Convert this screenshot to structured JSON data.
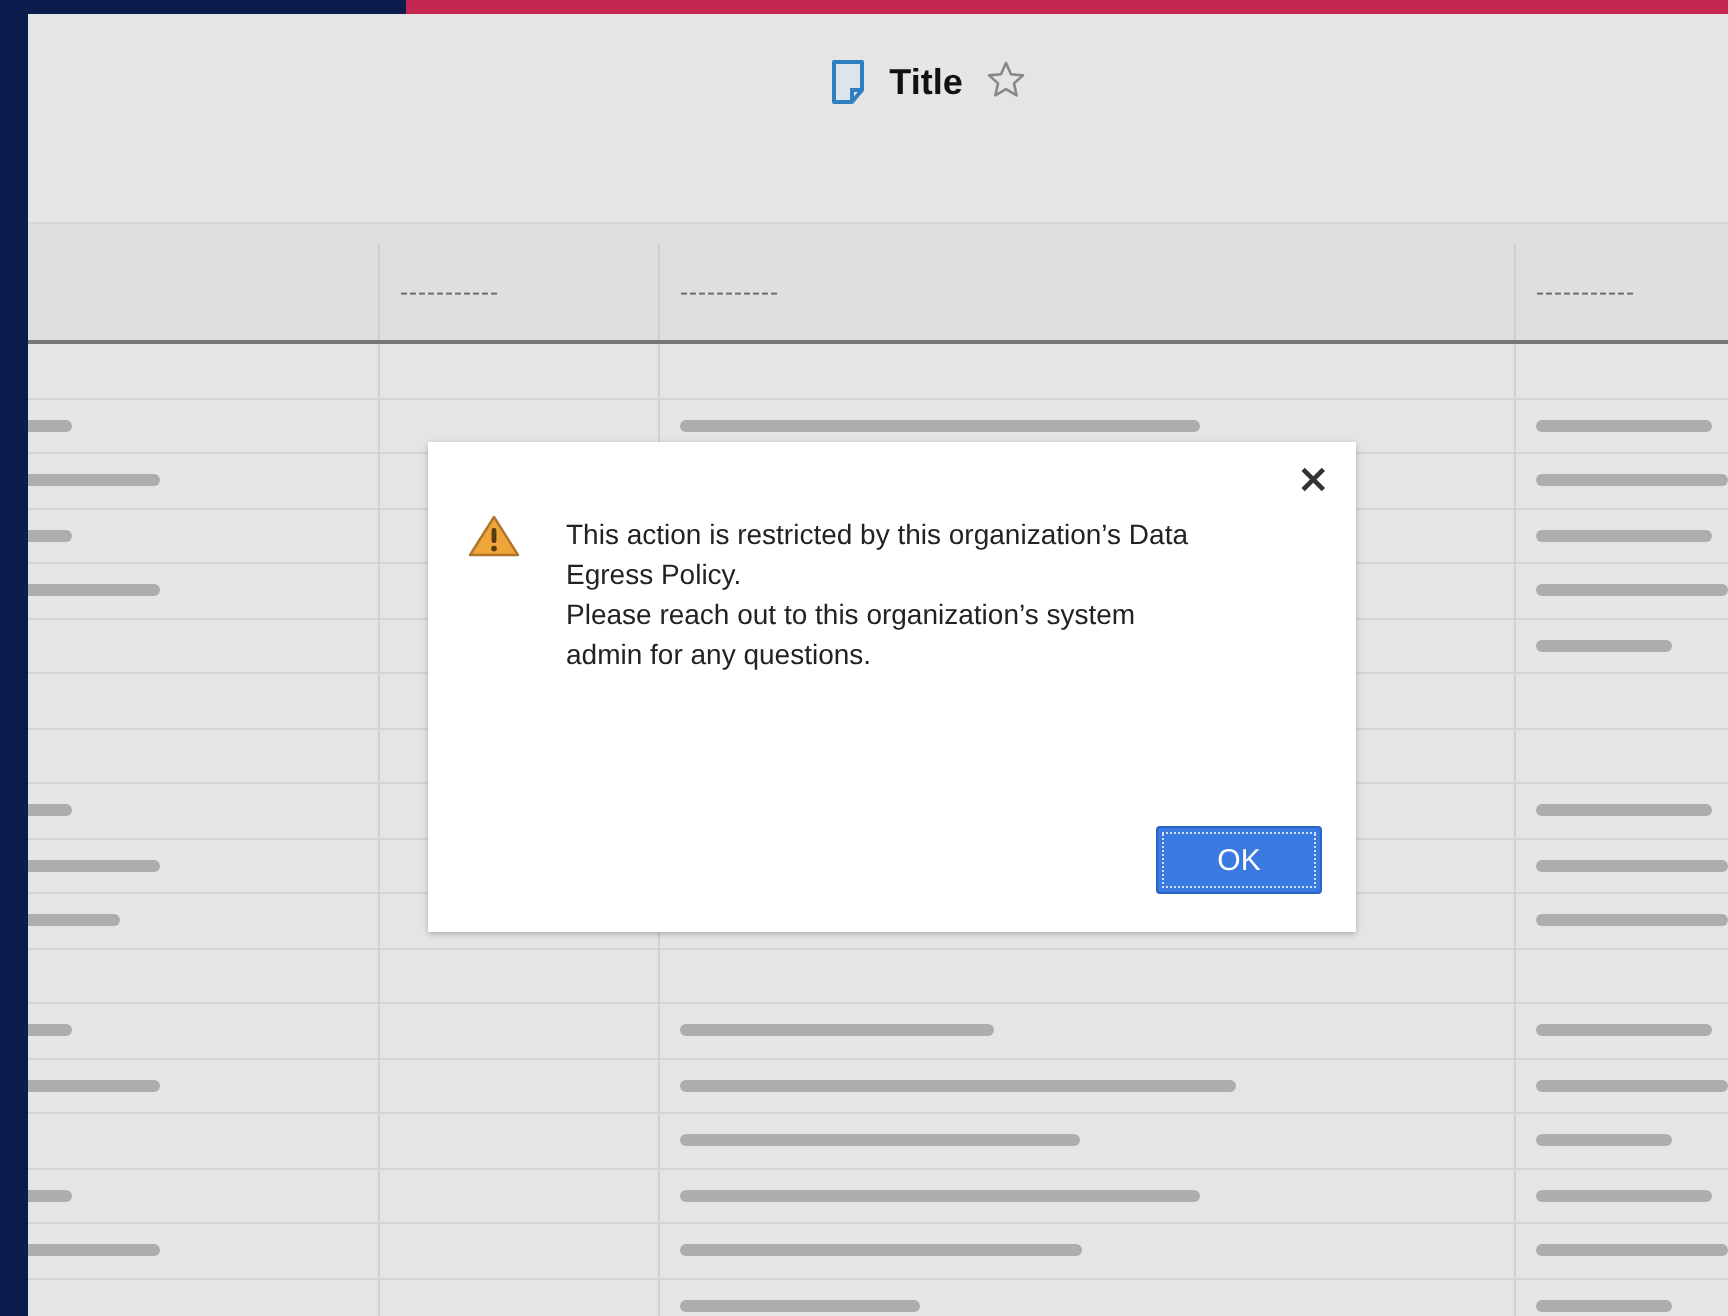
{
  "header": {
    "title": "Title"
  },
  "table": {
    "columns": [
      "-----------",
      "-----------",
      "-----------"
    ]
  },
  "dialog": {
    "close": "×",
    "messages": [
      "This action is restricted by this organization’s Data Egress Policy.",
      "Please reach out to this organization’s system admin for any questions."
    ],
    "button": "OK"
  }
}
